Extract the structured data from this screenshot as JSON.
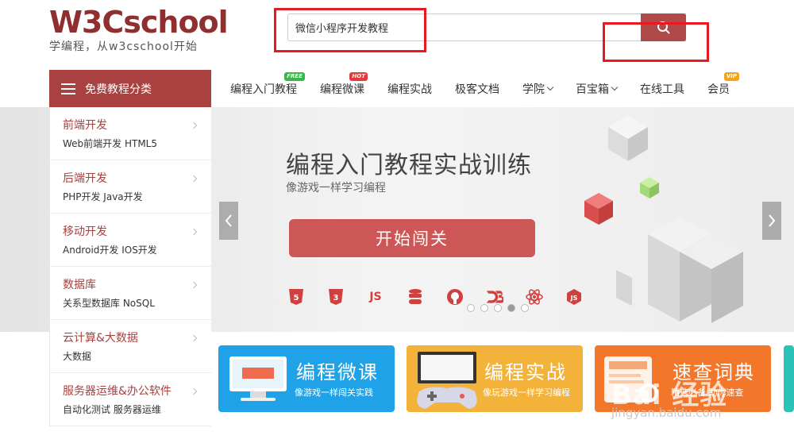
{
  "header": {
    "logo_main": "W3Cschool",
    "logo_sub": "学编程，从w3cschool开始",
    "search_value": "微信小程序开发教程",
    "search_icon": "search-icon"
  },
  "nav": {
    "category_label": "免费教程分类",
    "items": [
      {
        "label": "编程入门教程",
        "badge": "FREE"
      },
      {
        "label": "编程微课",
        "badge": "HOT"
      },
      {
        "label": "编程实战"
      },
      {
        "label": "极客文档"
      },
      {
        "label": "学院"
      },
      {
        "label": "百宝箱"
      },
      {
        "label": "在线工具"
      },
      {
        "label": "会员",
        "badge": "VIP"
      }
    ]
  },
  "sidebar": {
    "items": [
      {
        "title": "前端开发",
        "sub": "Web前端开发   HTML5"
      },
      {
        "title": "后端开发",
        "sub": "PHP开发   Java开发"
      },
      {
        "title": "移动开发",
        "sub": "Android开发   IOS开发"
      },
      {
        "title": "数据库",
        "sub": "关系型数据库   NoSQL"
      },
      {
        "title": "云计算&大数据",
        "sub": "大数据"
      },
      {
        "title": "服务器运维&办公软件",
        "sub": "自动化测试   服务器运维"
      }
    ]
  },
  "banner": {
    "title": "编程入门教程实战训练",
    "subtitle": "像游戏一样学习编程",
    "start_button": "开始闯关",
    "tech_icons": [
      "html5-icon",
      "css3-icon",
      "js-icon",
      "database-icon",
      "github-icon",
      "d3-icon",
      "react-icon",
      "nodejs-icon"
    ],
    "tech_labels": {
      "js": "JS"
    },
    "active_slide_index": 3,
    "slide_count": 5
  },
  "cards": [
    {
      "title": "编程微课",
      "sub": "像游戏一样闯关实践",
      "color": "#1fa2e8"
    },
    {
      "title": "编程实战",
      "sub": "像玩游戏一样学习编程",
      "color": "#f3b33a"
    },
    {
      "title": "速查词典",
      "sub": "精选必备 助你速查",
      "color": "#f2772a"
    }
  ],
  "watermark": {
    "main": "Bai 经验",
    "sub": "jingyan.baidu.com"
  },
  "colors": {
    "brand": "#a8413f",
    "annotation": "#e8181f"
  }
}
